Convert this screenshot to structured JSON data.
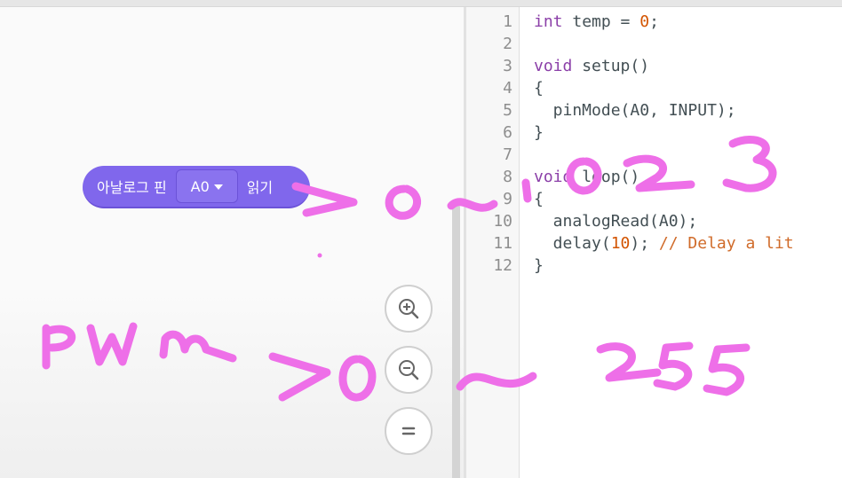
{
  "block": {
    "label_left": "아날로그 핀",
    "pin_value": "A0",
    "label_right": "읽기"
  },
  "zoom": {
    "in_icon": "zoom-in-icon",
    "out_icon": "zoom-out-icon",
    "reset_icon": "equals-icon"
  },
  "editor": {
    "lines": [
      {
        "n": "1",
        "text": "int temp = 0;"
      },
      {
        "n": "2",
        "text": ""
      },
      {
        "n": "3",
        "text": "void setup()"
      },
      {
        "n": "4",
        "text": "{"
      },
      {
        "n": "5",
        "text": "  pinMode(A0, INPUT);"
      },
      {
        "n": "6",
        "text": "}"
      },
      {
        "n": "7",
        "text": ""
      },
      {
        "n": "8",
        "text": "void loop()"
      },
      {
        "n": "9",
        "text": "{"
      },
      {
        "n": "10",
        "text": "  analogRead(A0);"
      },
      {
        "n": "11",
        "text": "  delay(10); // Delay a lit"
      },
      {
        "n": "12",
        "text": "}"
      }
    ]
  },
  "annotations": {
    "note_adc": ">0~1023",
    "note_pwm": "PWM >0 ~ 255",
    "ink_color": "#ee6fe8"
  }
}
